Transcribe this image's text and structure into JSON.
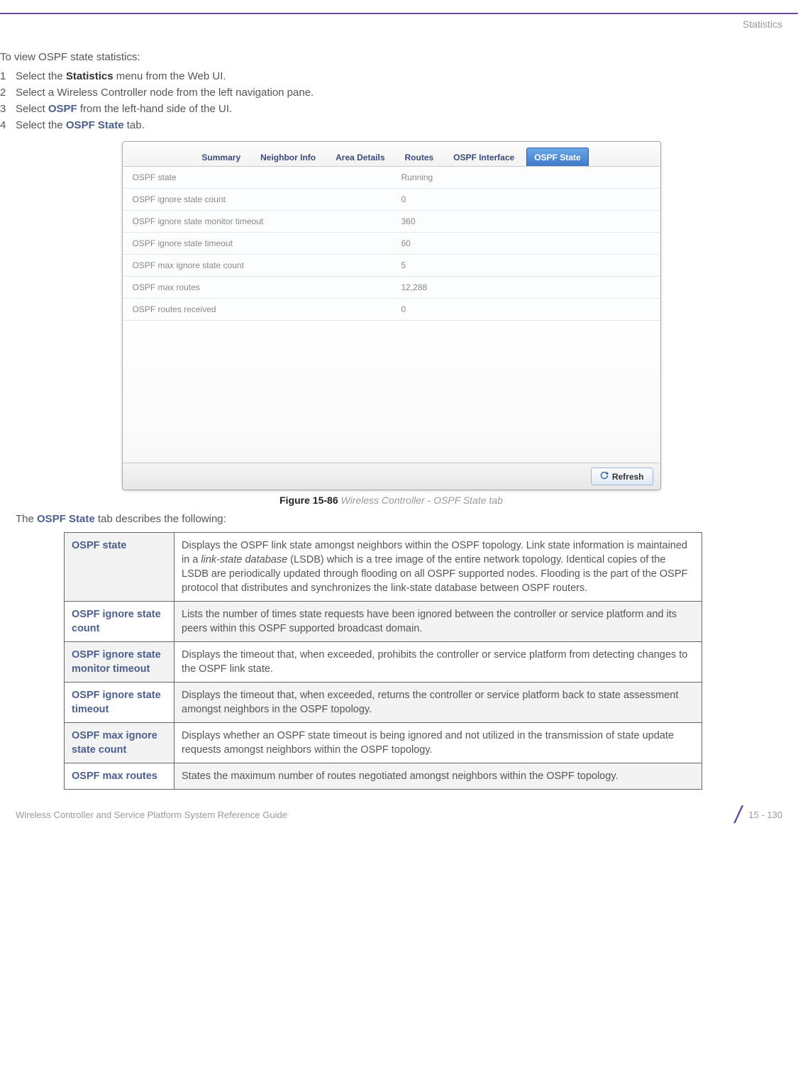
{
  "header": {
    "section": "Statistics"
  },
  "intro": "To view OSPF state statistics:",
  "steps": [
    {
      "n": "1",
      "pre": "Select the ",
      "bold": "Statistics",
      "post": " menu from the Web UI."
    },
    {
      "n": "2",
      "pre": "Select a Wireless Controller node from the left navigation pane.",
      "bold": "",
      "post": ""
    },
    {
      "n": "3",
      "pre": "Select ",
      "bold": "OSPF",
      "post": " from the left-hand side of the UI."
    },
    {
      "n": "4",
      "pre": "Select the ",
      "bold": "OSPF State",
      "post": " tab."
    }
  ],
  "shot": {
    "tabs": [
      "Summary",
      "Neighbor Info",
      "Area Details",
      "Routes",
      "OSPF Interface",
      "OSPF State"
    ],
    "active_tab_index": 5,
    "rows": [
      {
        "label": "OSPF state",
        "value": "Running"
      },
      {
        "label": "OSPF ignore state count",
        "value": "0"
      },
      {
        "label": "OSPF ignore state monitor timeout",
        "value": "360"
      },
      {
        "label": "OSPF ignore state timeout",
        "value": "60"
      },
      {
        "label": "OSPF max ignore state count",
        "value": "5"
      },
      {
        "label": "OSPF max routes",
        "value": "12,288"
      },
      {
        "label": "OSPF routes received",
        "value": "0"
      }
    ],
    "refresh": "Refresh"
  },
  "figure": {
    "num": "Figure 15-86",
    "title": "Wireless Controller - OSPF State tab"
  },
  "desc_intro_pre": "The ",
  "desc_intro_bold": "OSPF State",
  "desc_intro_post": " tab describes the following:",
  "desc": [
    {
      "k": "OSPF state",
      "v": "Displays the OSPF link state amongst neighbors within the OSPF topology. Link state information is maintained in a link-state database (LSDB) which is a tree image of the entire network topology. Identical copies of the LSDB are periodically updated through flooding on all OSPF supported nodes. Flooding is the part of the OSPF protocol that distributes and synchronizes the link-state database between OSPF routers."
    },
    {
      "k": "OSPF ignore state count",
      "v": "Lists the number of times state requests have been ignored between the controller or service platform and its peers within this OSPF supported broadcast domain."
    },
    {
      "k": "OSPF ignore state monitor timeout",
      "v": "Displays the timeout that, when exceeded, prohibits the controller or service platform from detecting changes to the OSPF link state."
    },
    {
      "k": "OSPF ignore state timeout",
      "v": "Displays the timeout that, when exceeded, returns the controller or service platform back to state assessment amongst neighbors in the OSPF topology."
    },
    {
      "k": "OSPF max ignore state count",
      "v": "Displays whether an OSPF state timeout is being ignored and not utilized in the transmission of state update requests amongst neighbors within the OSPF topology."
    },
    {
      "k": "OSPF max routes",
      "v": "States the maximum number of routes negotiated amongst neighbors within the OSPF topology."
    }
  ],
  "footer": {
    "guide": "Wireless Controller and Service Platform System Reference Guide",
    "page": "15 - 130"
  }
}
